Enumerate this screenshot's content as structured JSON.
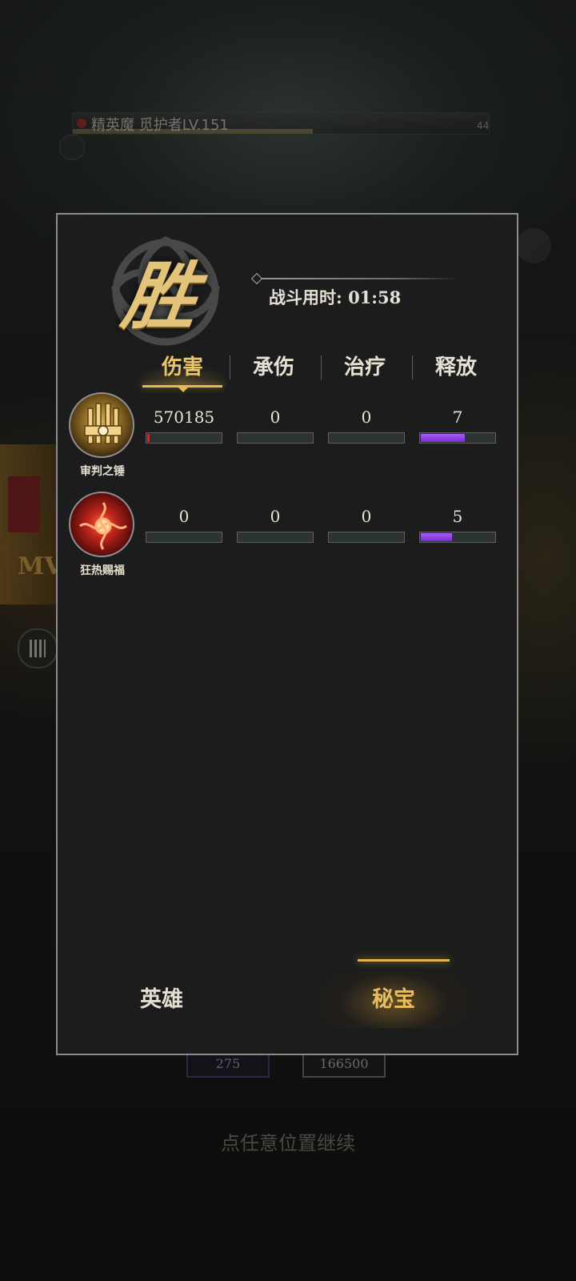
{
  "background": {
    "boss_name": "精英魔 觅护者LV.151",
    "boss_count": "44",
    "mvp_text": "MV",
    "item1_value": "275",
    "item2_value": "166500",
    "continue_hint": "点任意位置继续"
  },
  "result": {
    "title": "胜",
    "battle_time_label": "战斗用时: 01:58"
  },
  "tabs": [
    {
      "label": "伤害",
      "active": true
    },
    {
      "label": "承伤",
      "active": false
    },
    {
      "label": "治疗",
      "active": false
    },
    {
      "label": "释放",
      "active": false
    }
  ],
  "rows": [
    {
      "name": "审判之锤",
      "icon": "hammer-icon",
      "stats": [
        {
          "value": "570185",
          "fraction": 0.03,
          "color": "red"
        },
        {
          "value": "0",
          "fraction": 0,
          "color": "red"
        },
        {
          "value": "0",
          "fraction": 0,
          "color": "red"
        },
        {
          "value": "7",
          "fraction": 0.58,
          "color": "purple"
        }
      ]
    },
    {
      "name": "狂热赐福",
      "icon": "blessing-icon",
      "stats": [
        {
          "value": "0",
          "fraction": 0,
          "color": "red"
        },
        {
          "value": "0",
          "fraction": 0,
          "color": "red"
        },
        {
          "value": "0",
          "fraction": 0,
          "color": "red"
        },
        {
          "value": "5",
          "fraction": 0.41,
          "color": "purple"
        }
      ]
    }
  ],
  "bottom_tabs": {
    "heroes": "英雄",
    "treasure": "秘宝"
  }
}
